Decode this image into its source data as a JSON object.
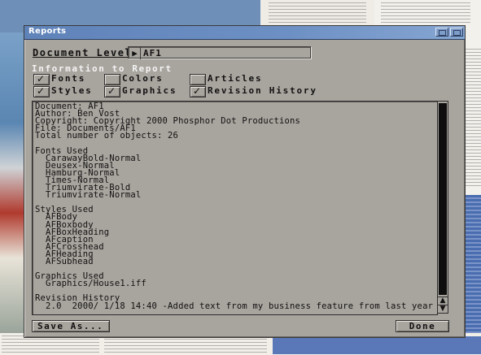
{
  "window": {
    "title": "Reports"
  },
  "document_level": {
    "label": "Document Level",
    "value": "AF1"
  },
  "info_section": {
    "heading": "Information to Report",
    "options": [
      {
        "label": "Fonts",
        "checked": true
      },
      {
        "label": "Colors",
        "checked": false
      },
      {
        "label": "Articles",
        "checked": false
      },
      {
        "label": "Styles",
        "checked": true
      },
      {
        "label": "Graphics",
        "checked": true
      },
      {
        "label": "Revision History",
        "checked": true
      }
    ]
  },
  "report": {
    "text": "Document: AF1\nAuthor: Ben Vost\nCopyright: Copyright 2000 Phosphor Dot Productions\nFile: Documents/AF1\nTotal number of objects: 26\n\nFonts Used\n  CarawayBold-Normal\n  Deusex-Normal\n  Hamburg-Normal\n  Times-Normal\n  Triumvirate-Bold\n  Triumvirate-Normal\n\nStyles Used\n  AFBody\n  AFBoxbody\n  AFBoxHeading\n  AFcaption\n  AFCrosshead\n  AFHeading\n  AFSubhead\n\nGraphics Used\n  Graphics/House1.iff\n\nRevision History\n  2.0  2000/ 1/18 14:40 -Added text from my business feature from last year"
  },
  "buttons": {
    "save": "Save As...",
    "done": "Done"
  },
  "icons": {
    "depth": "depth-gadget-icon",
    "zoom": "zoom-gadget-icon",
    "scroll_up": "scroll-up-arrow-icon",
    "scroll_down": "scroll-down-arrow-icon",
    "check": "checkmark-icon"
  }
}
